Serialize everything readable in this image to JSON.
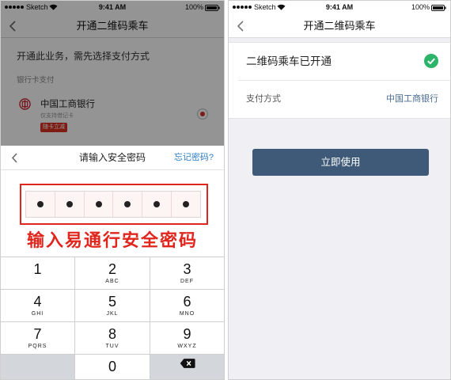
{
  "colors": {
    "annotation_red": "#e0261c",
    "link_blue": "#2f7fc8",
    "success_green": "#2bb46a",
    "button_bg": "#3e5a78",
    "value_text": "#4a6c92",
    "badge_red": "#d9301f"
  },
  "left_screen": {
    "status_bar": {
      "signal_icon": "signal-dots-icon",
      "carrier": "Sketch",
      "wifi_icon": "wifi-icon",
      "time": "9:41 AM",
      "battery": "100%",
      "battery_icon": "battery-icon"
    },
    "nav": {
      "back_icon": "chevron-left-icon",
      "title": "开通二维码乘车"
    },
    "intro": "开通此业务，需先选择支付方式",
    "section_label": "银行卡支付",
    "bank_option": {
      "logo_icon": "icbc-logo-icon",
      "name": "中国工商银行",
      "note": "仅支持借记卡",
      "badge": "随卡立减",
      "selected": true
    },
    "password_sheet": {
      "back_icon": "chevron-left-icon",
      "title": "请输入安全密码",
      "forgot_link": "忘记密码?",
      "digits_total": 6,
      "digits_entered": 6
    },
    "annotation": "输入易通行安全密码",
    "keypad": [
      {
        "digit": "1",
        "letters": ""
      },
      {
        "digit": "2",
        "letters": "ABC"
      },
      {
        "digit": "3",
        "letters": "DEF"
      },
      {
        "digit": "4",
        "letters": "GHI"
      },
      {
        "digit": "5",
        "letters": "JKL"
      },
      {
        "digit": "6",
        "letters": "MNO"
      },
      {
        "digit": "7",
        "letters": "PQRS"
      },
      {
        "digit": "8",
        "letters": "TUV"
      },
      {
        "digit": "9",
        "letters": "WXYZ"
      },
      {
        "digit": "",
        "letters": ""
      },
      {
        "digit": "0",
        "letters": ""
      },
      {
        "icon": "backspace-icon"
      }
    ]
  },
  "right_screen": {
    "status_bar": {
      "signal_icon": "signal-dots-icon",
      "carrier": "Sketch",
      "wifi_icon": "wifi-icon",
      "time": "9:41 AM",
      "battery": "100%",
      "battery_icon": "battery-icon"
    },
    "nav": {
      "back_icon": "chevron-left-icon",
      "title": "开通二维码乘车"
    },
    "success_row": {
      "text": "二维码乘车已开通",
      "icon": "check-circle-icon"
    },
    "payment_row": {
      "label": "支付方式",
      "value": "中国工商银行"
    },
    "primary_button": "立即使用"
  }
}
